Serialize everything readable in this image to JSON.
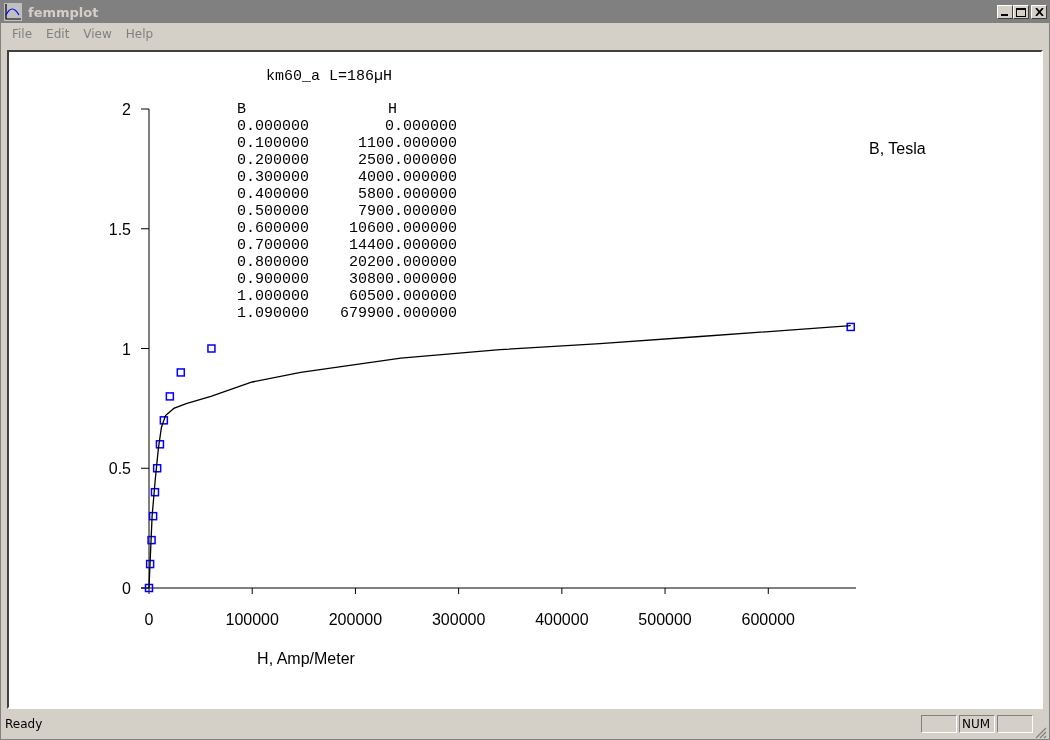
{
  "window": {
    "title": "femmplot"
  },
  "menu": [
    {
      "label": "File",
      "disabled": true
    },
    {
      "label": "Edit",
      "disabled": true
    },
    {
      "label": "View",
      "disabled": true
    },
    {
      "label": "Help",
      "disabled": true
    }
  ],
  "plot": {
    "heading": "km60_a L=186µH",
    "table": {
      "headers": [
        "B",
        "H"
      ],
      "rows": [
        [
          "0.000000",
          "0.000000"
        ],
        [
          "0.100000",
          "1100.000000"
        ],
        [
          "0.200000",
          "2500.000000"
        ],
        [
          "0.300000",
          "4000.000000"
        ],
        [
          "0.400000",
          "5800.000000"
        ],
        [
          "0.500000",
          "7900.000000"
        ],
        [
          "0.600000",
          "10600.000000"
        ],
        [
          "0.700000",
          "14400.000000"
        ],
        [
          "0.800000",
          "20200.000000"
        ],
        [
          "0.900000",
          "30800.000000"
        ],
        [
          "1.000000",
          "60500.000000"
        ],
        [
          "1.090000",
          "679900.000000"
        ]
      ]
    },
    "chart_data": {
      "type": "scatter",
      "xlabel": "H, Amp/Meter",
      "ylabel": "B, Tesla",
      "x": [
        0,
        1100,
        2500,
        4000,
        5800,
        7900,
        10600,
        14400,
        20200,
        30800,
        60500,
        679900
      ],
      "series": [
        {
          "color": "#0000ff",
          "values": [
            0,
            0.1,
            0.2,
            0.3,
            0.4,
            0.5,
            0.6,
            0.7,
            0.8,
            0.9,
            1.0,
            1.09
          ]
        },
        {
          "type": "line",
          "color": "#000000",
          "x": [
            0,
            3000,
            6000,
            9000,
            12000,
            16000,
            24000,
            36000,
            60000,
            100000,
            147000,
            244000,
            340000,
            437000,
            534000,
            680000
          ],
          "values": [
            0,
            0.3,
            0.45,
            0.58,
            0.67,
            0.72,
            0.75,
            0.77,
            0.8,
            0.86,
            0.9,
            0.96,
            0.995,
            1.02,
            1.05,
            1.095
          ]
        }
      ],
      "xlim": [
        0,
        685000
      ],
      "ylim": [
        0,
        2
      ],
      "xticks": [
        0,
        100000,
        200000,
        300000,
        400000,
        500000,
        600000
      ],
      "yticks": [
        0,
        {
          "value": 0.5,
          "label": "0.5"
        },
        1,
        {
          "value": 1.5,
          "label": "1.5"
        },
        2
      ]
    }
  },
  "status_bar": {
    "text": "Ready",
    "indicator": "NUM"
  }
}
